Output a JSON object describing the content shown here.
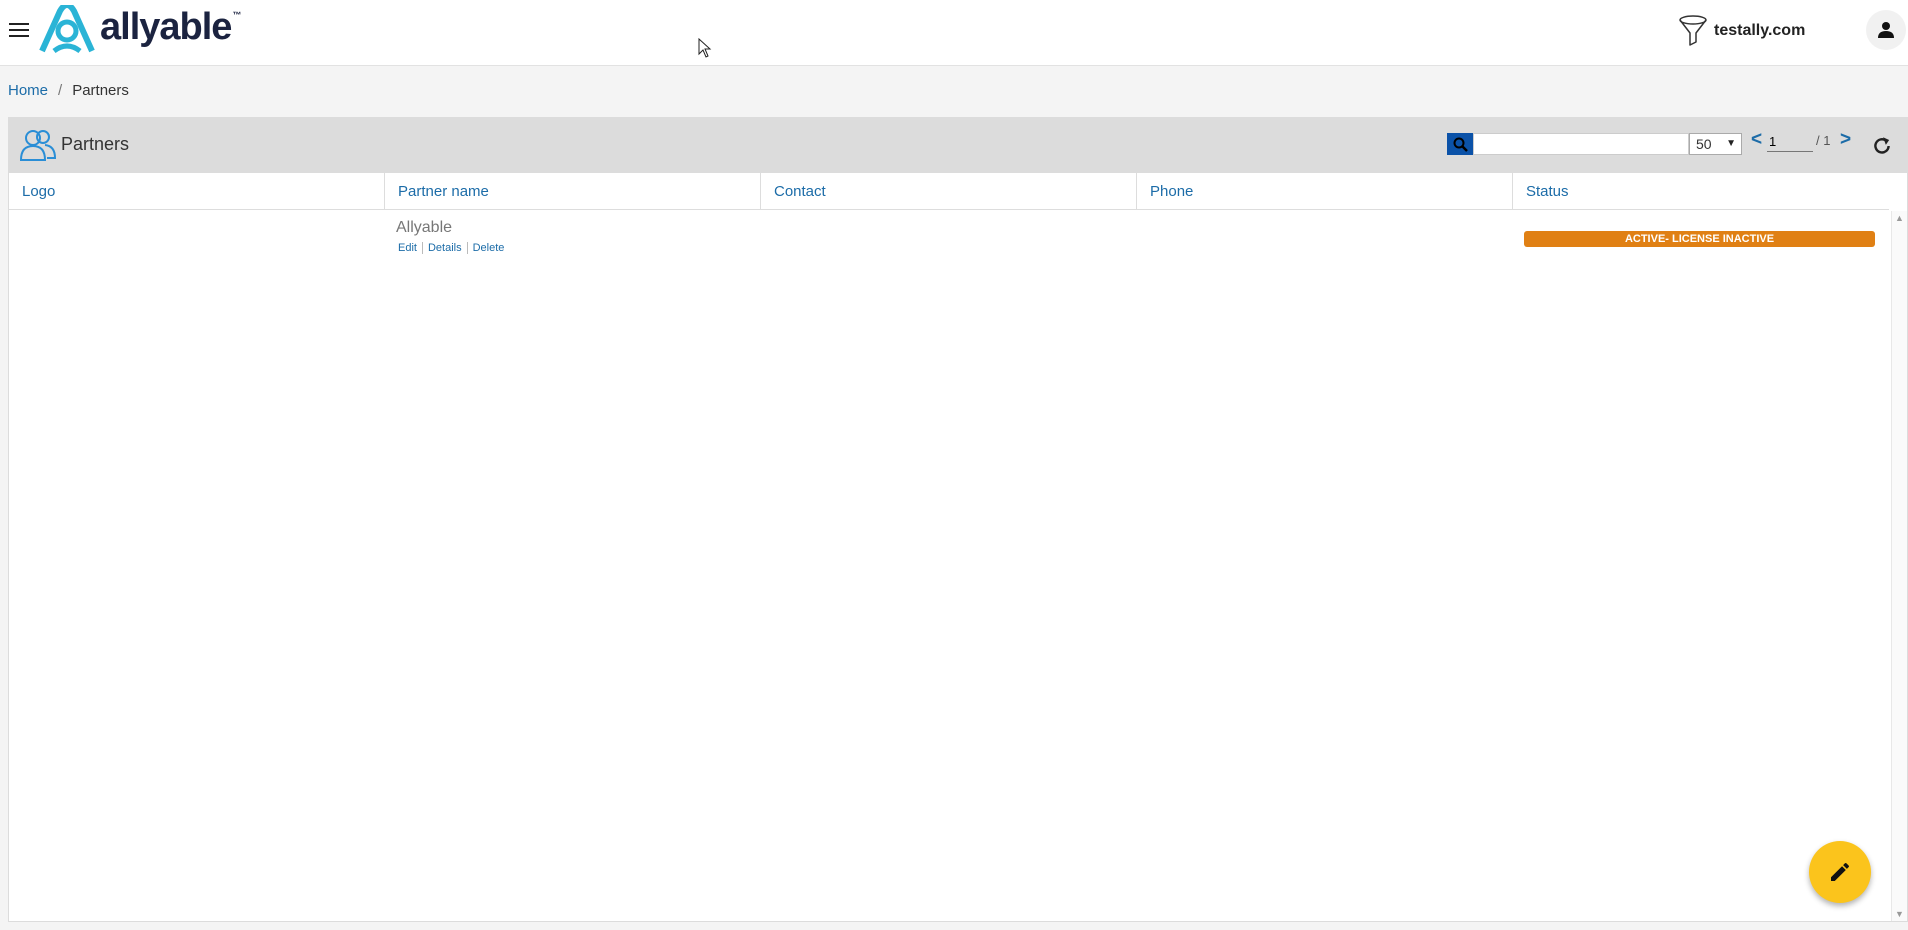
{
  "app": {
    "logo_text": "allyable",
    "logo_tm": "™",
    "domain": "testally.com"
  },
  "breadcrumb": {
    "home": "Home",
    "separator": "/",
    "current": "Partners"
  },
  "panel": {
    "title": "Partners",
    "search_value": "",
    "page_size": "50",
    "page_current": "1",
    "page_total": "/ 1",
    "prev_label": "<",
    "next_label": ">"
  },
  "table": {
    "columns": [
      "Logo",
      "Partner name",
      "Contact",
      "Phone",
      "Status"
    ],
    "rows": [
      {
        "logo": "",
        "partner_name": "Allyable",
        "actions": [
          "Edit",
          "Details",
          "Delete"
        ],
        "contact": "",
        "phone": "",
        "status": "ACTIVE- LICENSE INACTIVE"
      }
    ]
  },
  "colors": {
    "accent_blue": "#1c6ca8",
    "search_button": "#0b52a8",
    "status_orange": "#e08014",
    "fab_yellow": "#fbc41c",
    "logo_teal": "#2ab4d6",
    "logo_navy": "#1b2340"
  },
  "icons": {
    "menu": "hamburger-icon",
    "filter": "funnel-icon",
    "user": "user-icon",
    "partners": "users-icon",
    "search": "search-icon",
    "refresh": "refresh-icon",
    "fab": "pencil-icon"
  }
}
